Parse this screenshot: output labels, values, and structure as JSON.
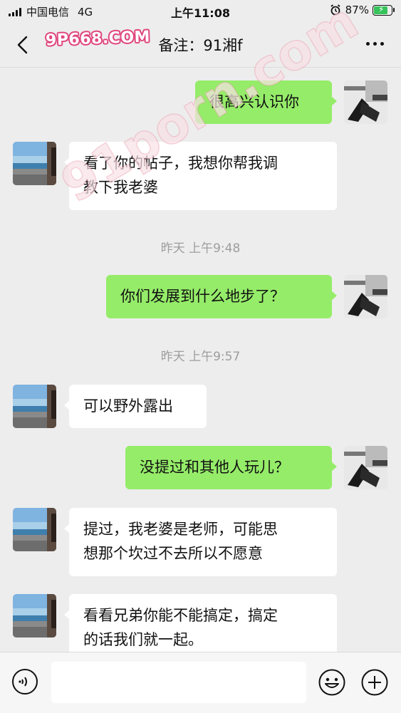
{
  "status_bar": {
    "carrier": "中国电信",
    "network": "4G",
    "time": "上午11:08",
    "battery": "87%",
    "battery_level": 0.87
  },
  "navbar": {
    "title": "备注：91湘f",
    "back_icon": "chevron-left-icon",
    "more_icon": "more-horizontal-icon"
  },
  "watermarks": {
    "top": "9P668.COM",
    "diagonal": "91porn.com"
  },
  "messages": [
    {
      "side": "out",
      "text": "很高兴认识你"
    },
    {
      "side": "in",
      "lines": [
        "看了你的帖子，我想你帮我调",
        "教下我老婆"
      ]
    },
    {
      "type": "time",
      "text": "昨天 上午9:48"
    },
    {
      "side": "out",
      "text": "你们发展到什么地步了？"
    },
    {
      "type": "time",
      "text": "昨天 上午9:57"
    },
    {
      "side": "in",
      "text": "可以野外露出"
    },
    {
      "side": "out",
      "text": "没提过和其他人玩儿？"
    },
    {
      "side": "in",
      "lines": [
        "提过，我老婆是老师，可能思",
        "想那个坎过不去所以不愿意"
      ]
    },
    {
      "side": "in",
      "lines": [
        "看看兄弟你能不能搞定，搞定",
        "的话我们就一起。"
      ]
    }
  ],
  "input_bar": {
    "voice_icon": "voice-icon",
    "emoji_icon": "emoji-icon",
    "plus_icon": "plus-circle-icon",
    "text": ""
  },
  "colors": {
    "background": "#ededed",
    "outgoing_bubble": "#95ec69",
    "incoming_bubble": "#ffffff",
    "watermark": "#e0457c"
  }
}
